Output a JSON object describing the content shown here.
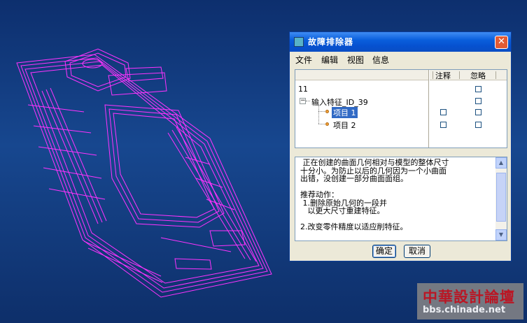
{
  "dialog": {
    "title": "故障排除器",
    "menu": [
      "文件",
      "编辑",
      "视图",
      "信息"
    ],
    "columns": {
      "note": "注释",
      "ignore": "忽略"
    },
    "tree": {
      "root": "11",
      "feature": "输入特征_ID_39",
      "items": [
        "项目 1",
        "项目 2"
      ],
      "selected_item": "项目 1"
    },
    "message": " 正在创建的曲面几何相对与模型的整体尺寸\n十分小。为防止以后的几何因为一个小曲面\n出错，没创建一部分曲面面组。\n\n推荐动作：\n 1.删除原始几何的一段并\n   以更大尺寸重建特征。\n\n2.改变零件精度以适应削特征。",
    "ok_label": "确定",
    "cancel_label": "取消"
  },
  "watermark": {
    "line1": "中華設計論壇",
    "line2": "bbs.chinade.net"
  },
  "colors": {
    "background": "#17478f",
    "wireframe": "#ff00ff",
    "titlebar": "#0a5fdc"
  }
}
